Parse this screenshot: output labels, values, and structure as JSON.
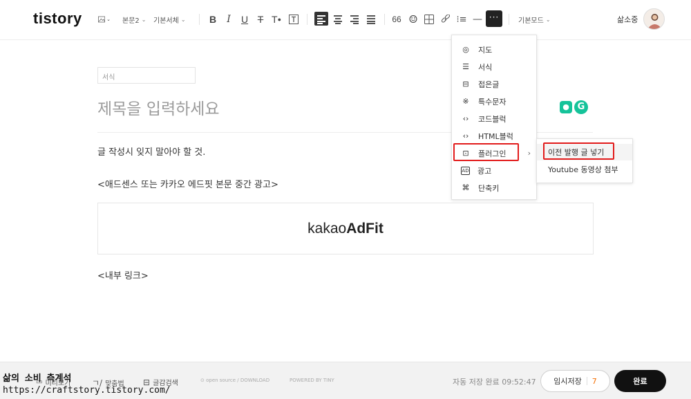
{
  "header": {
    "logo": "tistory",
    "toolbar": {
      "paragraph_style": "본문2",
      "font": "기본서체",
      "quote_icon": "66",
      "more_icon": "···",
      "mode": "기본모드"
    },
    "user_name": "삶소중"
  },
  "editor": {
    "category_placeholder": "서식",
    "title_placeholder": "제목을 입력하세요",
    "paragraphs": [
      "글 작성시 잊지 말아야 할 것.",
      "<애드센스 또는 카카오 에드핏 본문 중간 광고>",
      "<내부 링크>"
    ],
    "ad_box": {
      "brand_light": "kakao",
      "brand_bold": "AdFit"
    }
  },
  "more_menu": {
    "items": [
      {
        "label": "지도",
        "icon": "map-pin-icon",
        "glyph": "◎"
      },
      {
        "label": "서식",
        "icon": "template-icon",
        "glyph": "☰"
      },
      {
        "label": "접은글",
        "icon": "fold-icon",
        "glyph": "⊟"
      },
      {
        "label": "특수문자",
        "icon": "special-char-icon",
        "glyph": "※"
      },
      {
        "label": "코드블럭",
        "icon": "code-icon",
        "glyph": "‹›"
      },
      {
        "label": "HTML블럭",
        "icon": "html-icon",
        "glyph": "‹›"
      },
      {
        "label": "플러그인",
        "icon": "plugin-icon",
        "glyph": "⊡",
        "arrow": "›"
      },
      {
        "label": "광고",
        "icon": "ad-icon",
        "glyph": "AD"
      },
      {
        "label": "단축키",
        "icon": "shortcut-icon",
        "glyph": "⌘"
      }
    ]
  },
  "plugin_submenu": {
    "items": [
      {
        "label": "이전 발행 글 넣기"
      },
      {
        "label": "Youtube 동영상 첨부"
      }
    ]
  },
  "footer": {
    "preview": "미리보기",
    "spellcheck": "맞춤법",
    "search": "글감검색",
    "open_source": "open source / DOWNLOAD",
    "powered": "POWERED BY TINY",
    "autosave": "자동 저장 완료 09:52:47",
    "draft_label": "임시저장",
    "draft_count": "7",
    "done_label": "완료"
  },
  "watermark": {
    "line1": "삶의 소비 측계석",
    "line2": "https://craftstory.tistory.com/"
  },
  "colors": {
    "highlight": "#e21b1b",
    "draft_count": "#f56e00",
    "grammarly": "#15c39a"
  }
}
